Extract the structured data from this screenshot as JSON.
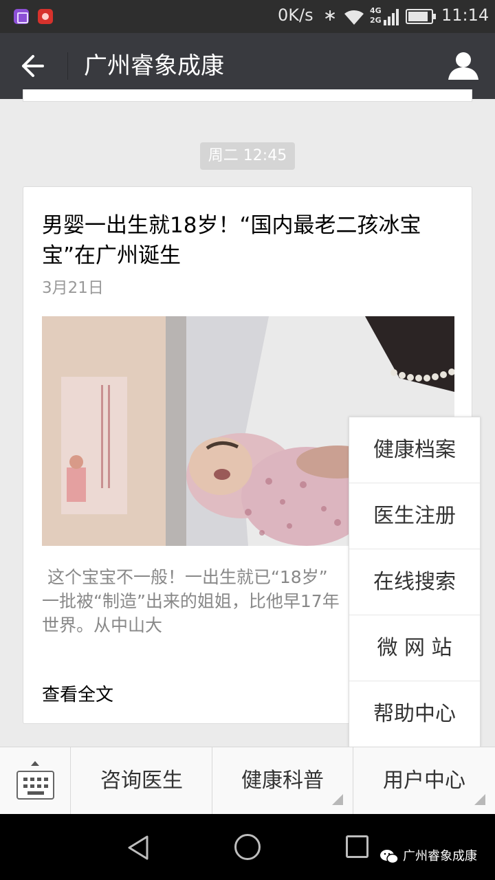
{
  "status_bar": {
    "network_speed": "0K/s",
    "network_type_top": "4G",
    "network_type_bottom": "2G",
    "time": "11:14"
  },
  "header": {
    "title": "广州睿象成康"
  },
  "chat": {
    "timestamp": "周二 12:45",
    "article": {
      "title": "男婴一出生就18岁！“国内最老二孩冰宝宝”在广州诞生",
      "date": "3月21日",
      "summary": " 这个宝宝不一般！一出生就已“18岁”\n一批被“制造”出来的姐姐，比他早17年\n世界。从中山大",
      "read_full_label": "查看全文"
    }
  },
  "popup_menu": {
    "items": [
      "健康档案",
      "医生注册",
      "在线搜索",
      "微 网 站",
      "帮助中心"
    ]
  },
  "bottom_menu": {
    "items": [
      "咨询医生",
      "健康科普",
      "用户中心"
    ]
  },
  "watermark": {
    "text": "广州睿象成康"
  },
  "colors": {
    "header_bg": "#393a3f",
    "status_bg": "#2e2e2e",
    "chat_bg": "#ebebeb",
    "timestamp_bg": "#d5d5d5"
  }
}
